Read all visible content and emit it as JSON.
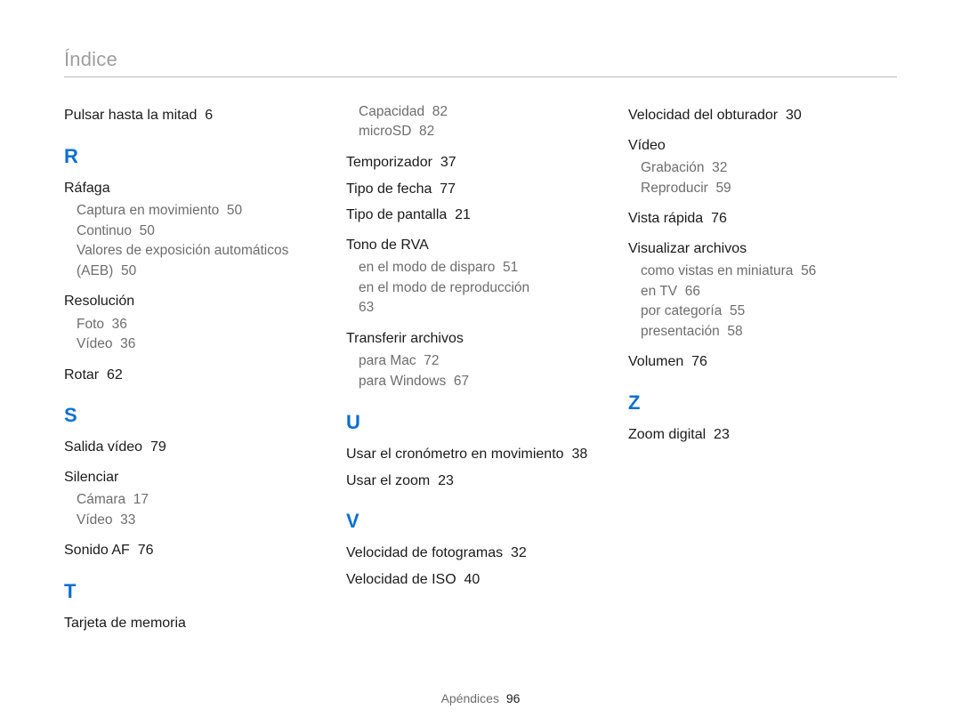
{
  "header": {
    "title": "Índice"
  },
  "col1": {
    "top_entry": {
      "text": "Pulsar hasta la mitad",
      "page": "6"
    },
    "R": {
      "letter": "R",
      "items": [
        {
          "text": "Ráfaga",
          "subs": [
            {
              "text": "Captura en movimiento",
              "page": "50"
            },
            {
              "text": "Continuo",
              "page": "50"
            },
            {
              "text": "Valores de exposición automáticos (AEB)",
              "page": "50"
            }
          ]
        },
        {
          "text": "Resolución",
          "subs": [
            {
              "text": "Foto",
              "page": "36"
            },
            {
              "text": "Vídeo",
              "page": "36"
            }
          ]
        },
        {
          "text": "Rotar",
          "page": "62"
        }
      ]
    },
    "S": {
      "letter": "S",
      "items": [
        {
          "text": "Salida vídeo",
          "page": "79"
        },
        {
          "text": "Silenciar",
          "subs": [
            {
              "text": "Cámara",
              "page": "17"
            },
            {
              "text": "Vídeo",
              "page": "33"
            }
          ]
        },
        {
          "text": "Sonido AF",
          "page": "76"
        }
      ]
    },
    "T": {
      "letter": "T",
      "items": [
        {
          "text": "Tarjeta de memoria"
        }
      ]
    }
  },
  "col2": {
    "top_subs": [
      {
        "text": "Capacidad",
        "page": "82"
      },
      {
        "text": "microSD",
        "page": "82"
      }
    ],
    "entries": [
      {
        "text": "Temporizador",
        "page": "37"
      },
      {
        "text": "Tipo de fecha",
        "page": "77"
      },
      {
        "text": "Tipo de pantalla",
        "page": "21"
      },
      {
        "text": "Tono de RVA",
        "subs": [
          {
            "text": "en el modo de disparo",
            "page": "51"
          },
          {
            "text": "en el modo de reproducción",
            "page": "63"
          }
        ]
      },
      {
        "text": "Transferir archivos",
        "subs": [
          {
            "text": "para Mac",
            "page": "72"
          },
          {
            "text": "para Windows",
            "page": "67"
          }
        ]
      }
    ],
    "U": {
      "letter": "U",
      "items": [
        {
          "text": "Usar el cronómetro en movimiento",
          "page": "38"
        },
        {
          "text": "Usar el zoom",
          "page": "23"
        }
      ]
    },
    "V": {
      "letter": "V",
      "items": [
        {
          "text": "Velocidad de fotogramas",
          "page": "32"
        },
        {
          "text": "Velocidad de ISO",
          "page": "40"
        }
      ]
    }
  },
  "col3": {
    "entries_top": [
      {
        "text": "Velocidad del obturador",
        "page": "30"
      },
      {
        "text": "Vídeo",
        "subs": [
          {
            "text": "Grabación",
            "page": "32"
          },
          {
            "text": "Reproducir",
            "page": "59"
          }
        ]
      },
      {
        "text": "Vista rápida",
        "page": "76"
      },
      {
        "text": "Visualizar archivos",
        "subs": [
          {
            "text": "como vistas en miniatura",
            "page": "56"
          },
          {
            "text": "en TV",
            "page": "66"
          },
          {
            "text": "por categoría",
            "page": "55"
          },
          {
            "text": "presentación",
            "page": "58"
          }
        ]
      },
      {
        "text": "Volumen",
        "page": "76"
      }
    ],
    "Z": {
      "letter": "Z",
      "items": [
        {
          "text": "Zoom digital",
          "page": "23"
        }
      ]
    }
  },
  "footer": {
    "section": "Apéndices",
    "page": "96"
  }
}
